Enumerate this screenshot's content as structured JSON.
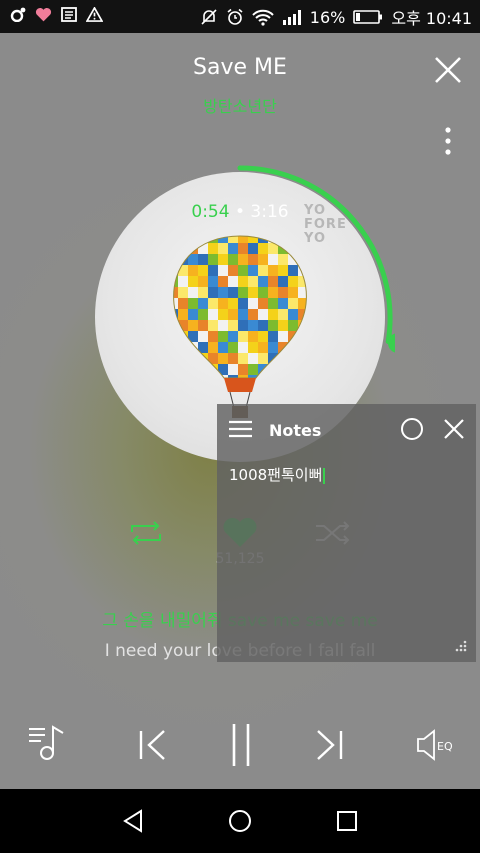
{
  "status_bar": {
    "battery": "16%",
    "time": "오후 10:41",
    "icons": [
      "app-notification-icon",
      "heart-notification-icon",
      "message-icon",
      "warning-icon",
      "mute-icon",
      "alarm-icon",
      "wifi-icon",
      "signal-icon",
      "battery-icon"
    ]
  },
  "player": {
    "title": "Save ME",
    "artist": "방탄소년단",
    "current_time": "0:54",
    "separator": "•",
    "total_time": "3:16",
    "progress": 0.275,
    "album_text": "YO\nFORE\nYO",
    "like_count": "51,125",
    "liked": true
  },
  "lyrics": {
    "current": "그 손을 내밀어줘 save me save me",
    "next": "I need your love before I fall fall"
  },
  "notes_window": {
    "title": "Notes",
    "text": "1008팬톡이뻐"
  },
  "colors": {
    "accent": "#39d04e",
    "background": "#8b8b8b",
    "notes_bg": "#626262"
  }
}
